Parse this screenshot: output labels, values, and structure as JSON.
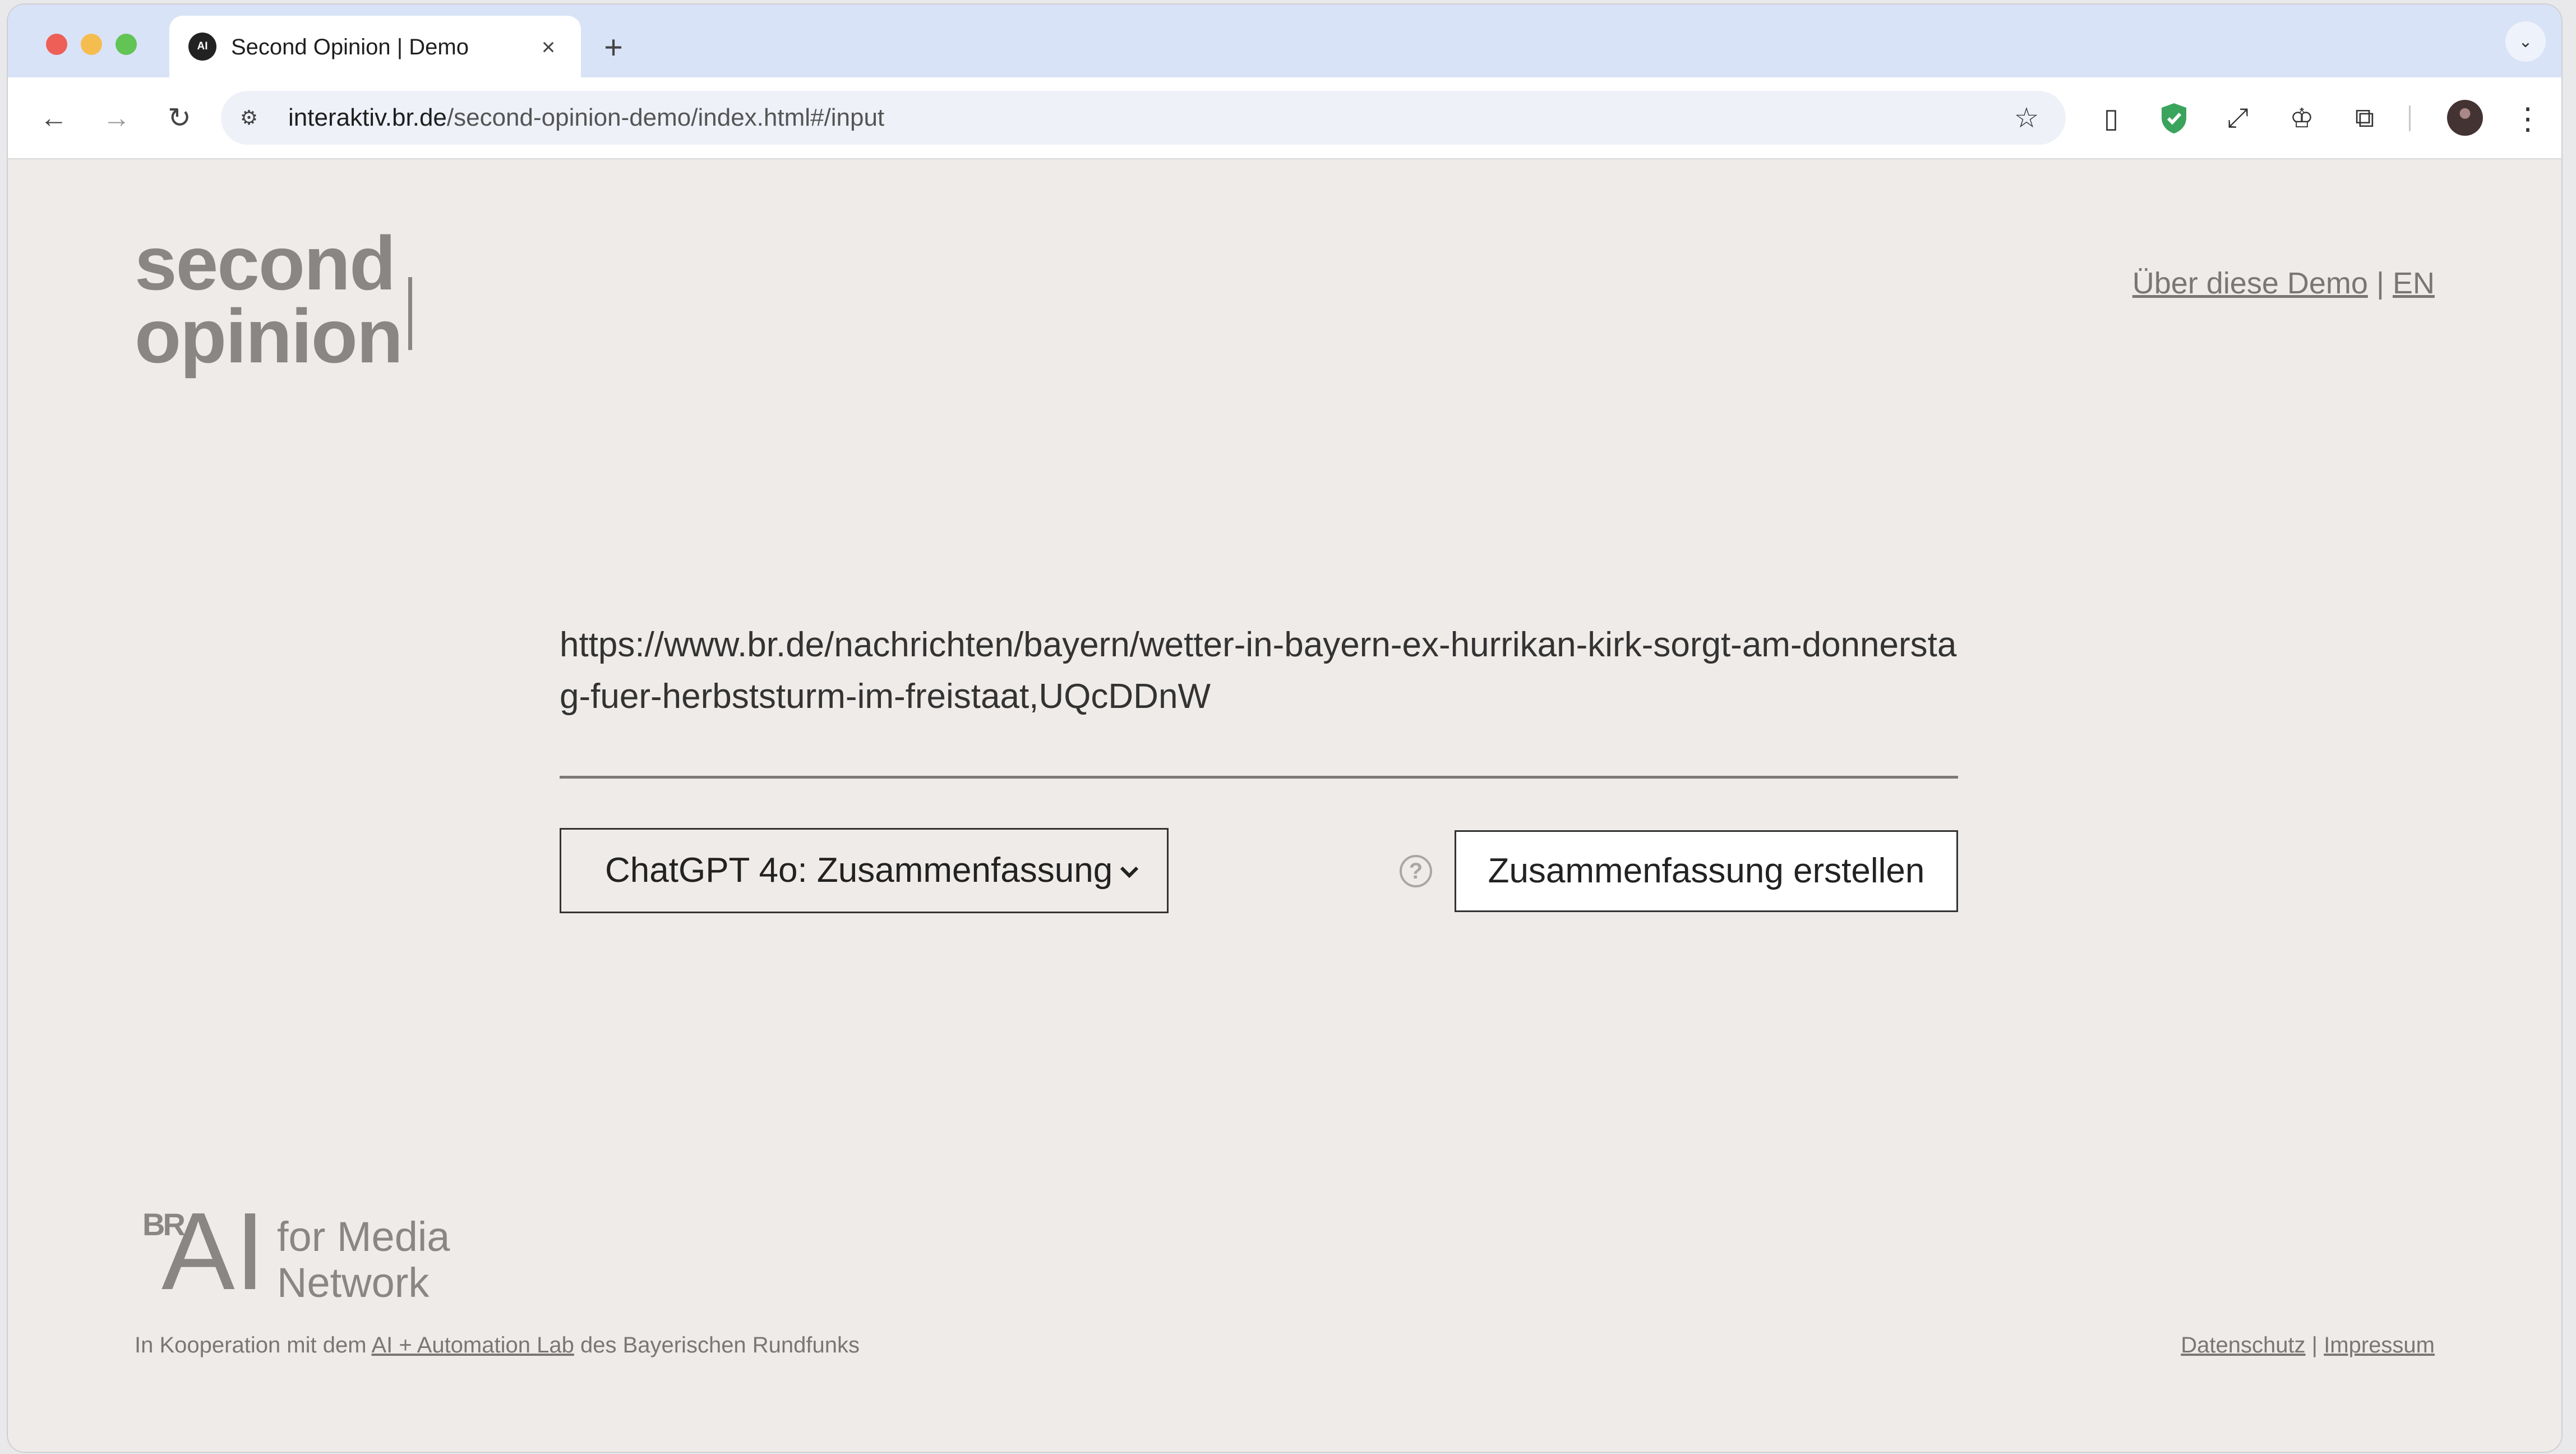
{
  "browser": {
    "tab": {
      "title": "Second Opinion | Demo",
      "favicon": "AI"
    },
    "new_tab_label": "+",
    "close_tab_label": "×",
    "tab_search_label": "⌄",
    "url": {
      "host": "interaktiv.br.de",
      "path": "/second-opinion-demo/index.html#/input"
    },
    "nav": {
      "back": "←",
      "forward": "→",
      "reload": "↻",
      "site_info": "⚙",
      "star": "☆",
      "menu": "⋮"
    },
    "extensions": [
      "▯",
      "◈",
      "⤢",
      "♔",
      "⧉"
    ]
  },
  "page": {
    "logo": {
      "line1": "second",
      "line2": "opinion"
    },
    "top_links": {
      "about": "Über diese Demo",
      "separator": "|",
      "language": "EN"
    },
    "input": {
      "value": "https://www.br.de/nachrichten/bayern/wetter-in-bayern-ex-hurrikan-kirk-sorgt-am-donnerstag-fuer-herbststurm-im-freistaat,UQcDDnW"
    },
    "model_select": {
      "selected": "ChatGPT 4o: Zusammenfassung"
    },
    "help": "?",
    "submit_label": "Zusammenfassung erstellen",
    "footer_logo": {
      "br": "BR",
      "ai": "AI",
      "text": "for Media\nNetwork"
    },
    "footer": {
      "prefix": "In Kooperation mit dem ",
      "lab_link": "AI + Automation Lab",
      "suffix": " des Bayerischen Rundfunks",
      "privacy": "Datenschutz",
      "separator": "|",
      "imprint": "Impressum"
    }
  },
  "colors": {
    "page_bg": "#efebe8",
    "tabstrip_bg": "#d9e3f7",
    "logo_grey": "#8a8683"
  }
}
